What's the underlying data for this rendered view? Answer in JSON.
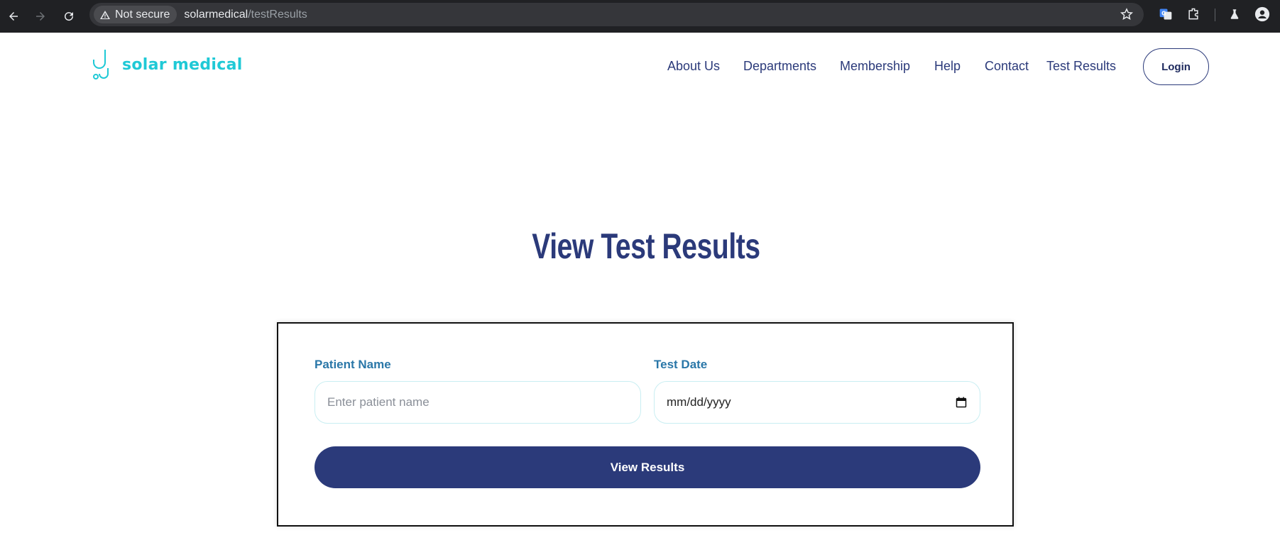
{
  "browser": {
    "security_label": "Not secure",
    "url_host": "solarmedical",
    "url_path": "/testResults"
  },
  "header": {
    "logo_text": "solar medical",
    "nav": [
      "About Us",
      "Departments",
      "Membership",
      "Help",
      "Contact",
      "Test Results"
    ],
    "login_label": "Login"
  },
  "main": {
    "title": "View Test Results",
    "form": {
      "patient_label": "Patient Name",
      "patient_placeholder": "Enter patient name",
      "date_label": "Test Date",
      "date_placeholder": "mm/dd/yyyy",
      "submit_label": "View Results"
    }
  },
  "colors": {
    "brand": "#1fc9d6",
    "primary": "#2b3a7a",
    "label": "#2a77a8"
  }
}
